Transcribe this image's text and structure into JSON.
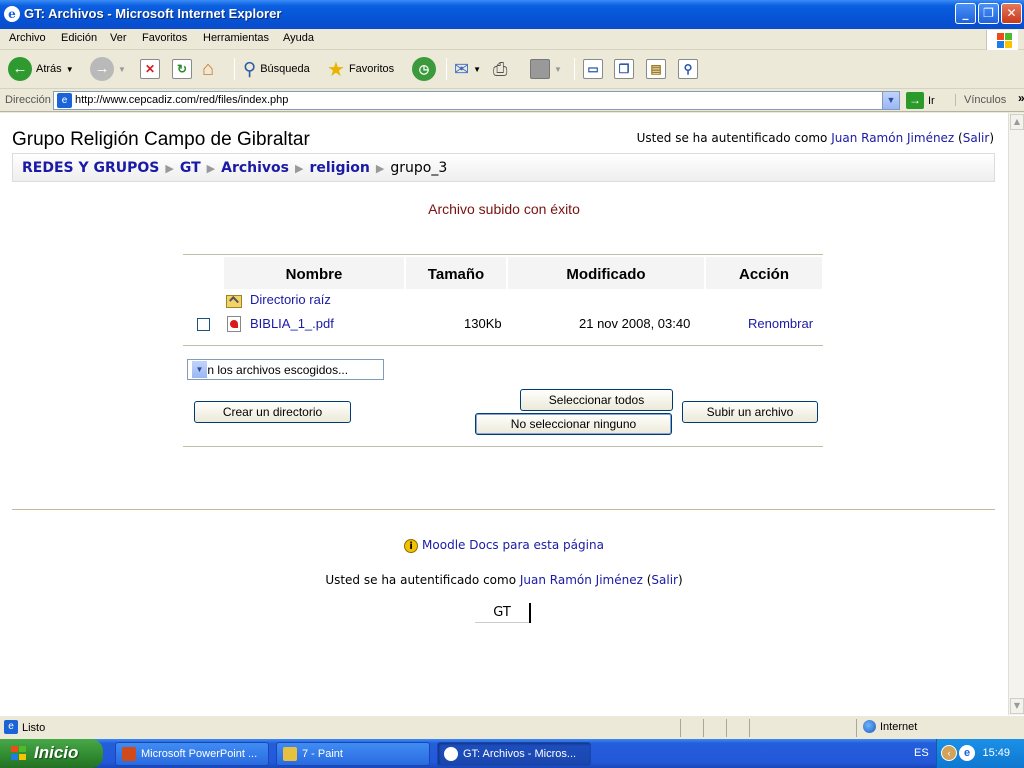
{
  "window": {
    "title": "GT: Archivos - Microsoft Internet Explorer"
  },
  "menubar": {
    "items": [
      "Archivo",
      "Edición",
      "Ver",
      "Favoritos",
      "Herramientas",
      "Ayuda"
    ]
  },
  "toolbar": {
    "back_label": "Atrás",
    "search_label": "Búsqueda",
    "favorites_label": "Favoritos"
  },
  "address": {
    "label": "Dirección",
    "url": "http://www.cepcadiz.com/red/files/index.php",
    "go_label": "Ir",
    "links_label": "Vínculos"
  },
  "page": {
    "site_title": "Grupo Religión Campo de Gibraltar",
    "login": {
      "prefix": "Usted se ha autentificado como",
      "user": "Juan Ramón Jiménez",
      "logout": "Salir"
    },
    "breadcrumb": [
      "REDES Y GRUPOS",
      "GT",
      "Archivos",
      "religion"
    ],
    "breadcrumb_current": "grupo_3",
    "notice": "Archivo subido con éxito",
    "table": {
      "headers": [
        "Nombre",
        "Tamaño",
        "Modificado",
        "Acción"
      ],
      "parent_dir": "Directorio raíz",
      "files": [
        {
          "name": "BIBLIA_1_.pdf",
          "size": "130Kb",
          "modified": "21 nov 2008, 03:40",
          "action": "Renombrar"
        }
      ]
    },
    "with_selected": "Con los archivos escogidos...",
    "buttons": {
      "create_dir": "Crear un directorio",
      "select_all": "Seleccionar todos",
      "select_none": "No seleccionar ninguno",
      "upload": "Subir un archivo"
    },
    "docs_link": "Moodle Docs para esta página",
    "home_button": "GT"
  },
  "statusbar": {
    "text": "Listo",
    "zone": "Internet"
  },
  "taskbar": {
    "start": "Inicio",
    "tasks": [
      "Microsoft PowerPoint ...",
      "7 - Paint",
      "GT: Archivos - Micros..."
    ],
    "lang": "ES",
    "time": "15:49"
  }
}
